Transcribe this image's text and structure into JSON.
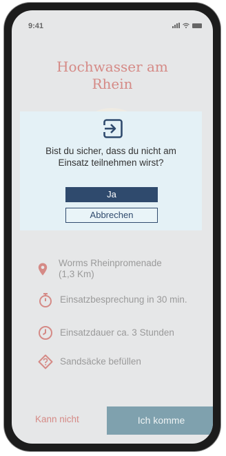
{
  "status_bar": {
    "time": "9:41"
  },
  "title": {
    "line1": "Hochwasser am",
    "line2": "Rhein"
  },
  "dialog": {
    "question_line1": "Bist du sicher, dass du nicht am",
    "question_line2": "Einsatz teilnehmen wirst?",
    "confirm_label": "Ja",
    "cancel_label": "Abbrechen",
    "icon": "exit-icon"
  },
  "details": [
    {
      "icon": "location-pin-icon",
      "line1": "Worms Rheinpromenade",
      "line2": "(1,3 Km)"
    },
    {
      "icon": "stopwatch-icon",
      "text": "Einsatzbesprechung in 30 min."
    },
    {
      "icon": "clock-icon",
      "text": "Einsatzdauer ca. 3 Stunden"
    },
    {
      "icon": "task-diamond-icon",
      "text": "Sandsäcke befüllen"
    }
  ],
  "actions": {
    "decline_label": "Kann nicht",
    "accept_label": "Ich komme"
  },
  "colors": {
    "accent": "#d58a86",
    "primary": "#2f4a6d",
    "dialog_background": "#e4f1f6",
    "accept_button": "#7fa1ae",
    "screen_background": "#e6e7e8"
  }
}
